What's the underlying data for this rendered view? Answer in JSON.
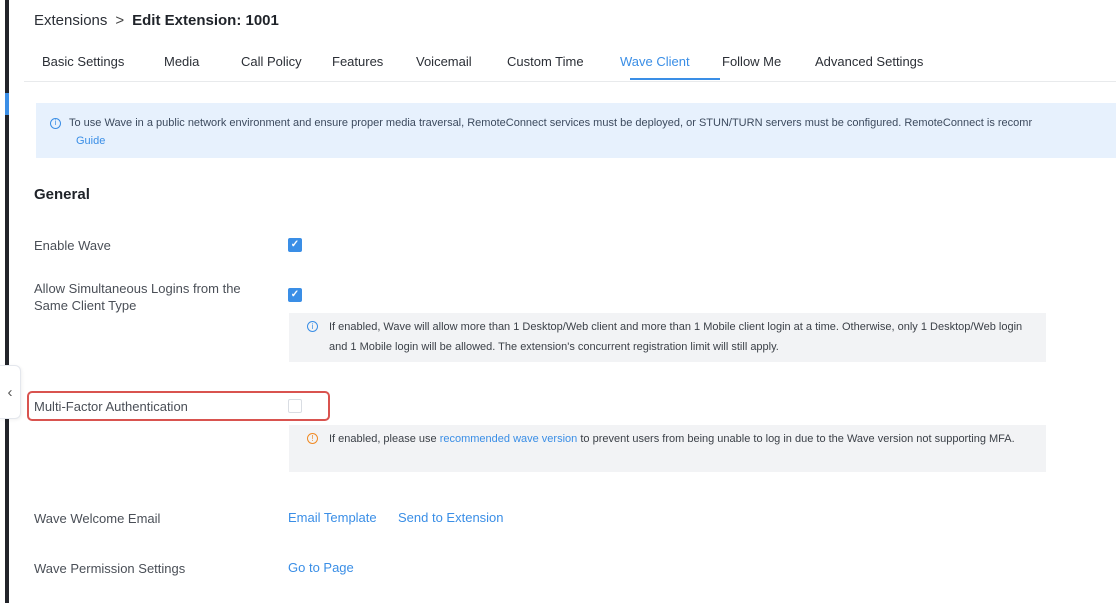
{
  "breadcrumb": {
    "parent": "Extensions",
    "separator": ">",
    "current": "Edit Extension: 1001"
  },
  "tabs": [
    {
      "label": "Basic Settings",
      "active": false
    },
    {
      "label": "Media",
      "active": false
    },
    {
      "label": "Call Policy",
      "active": false
    },
    {
      "label": "Features",
      "active": false
    },
    {
      "label": "Voicemail",
      "active": false
    },
    {
      "label": "Custom Time",
      "active": false
    },
    {
      "label": "Wave Client",
      "active": true
    },
    {
      "label": "Follow Me",
      "active": false
    },
    {
      "label": "Advanced Settings",
      "active": false
    }
  ],
  "notice": {
    "icon": "info-icon",
    "text": "To use Wave in a public network environment and ensure proper media traversal, RemoteConnect services must be deployed, or STUN/TURN servers must be configured. RemoteConnect is recomr",
    "link": "Guide"
  },
  "general": {
    "title": "General",
    "enable_wave": {
      "label": "Enable Wave",
      "checked": true
    },
    "simultaneous_logins": {
      "label": "Allow Simultaneous Logins from the Same Client Type",
      "checked": true,
      "hint": "If enabled, Wave will allow more than 1 Desktop/Web client and more than 1 Mobile client login at a time. Otherwise, only 1 Desktop/Web login and 1 Mobile login will be allowed. The extension's concurrent registration limit will still apply."
    },
    "mfa": {
      "label": "Multi-Factor Authentication",
      "checked": false,
      "hint_before": "If enabled, please use",
      "hint_link": "recommended wave version",
      "hint_after": "to prevent users from being unable to log in due to the Wave version not supporting MFA."
    },
    "welcome_email": {
      "label": "Wave Welcome Email",
      "link_template": "Email Template",
      "link_send": "Send to Extension"
    },
    "permission_settings": {
      "label": "Wave Permission Settings",
      "link": "Go to Page"
    }
  },
  "colors": {
    "accent": "#3a8ee6",
    "notice_bg": "#e7f1fd",
    "highlight": "#d9534f",
    "warning": "#f08a24"
  }
}
